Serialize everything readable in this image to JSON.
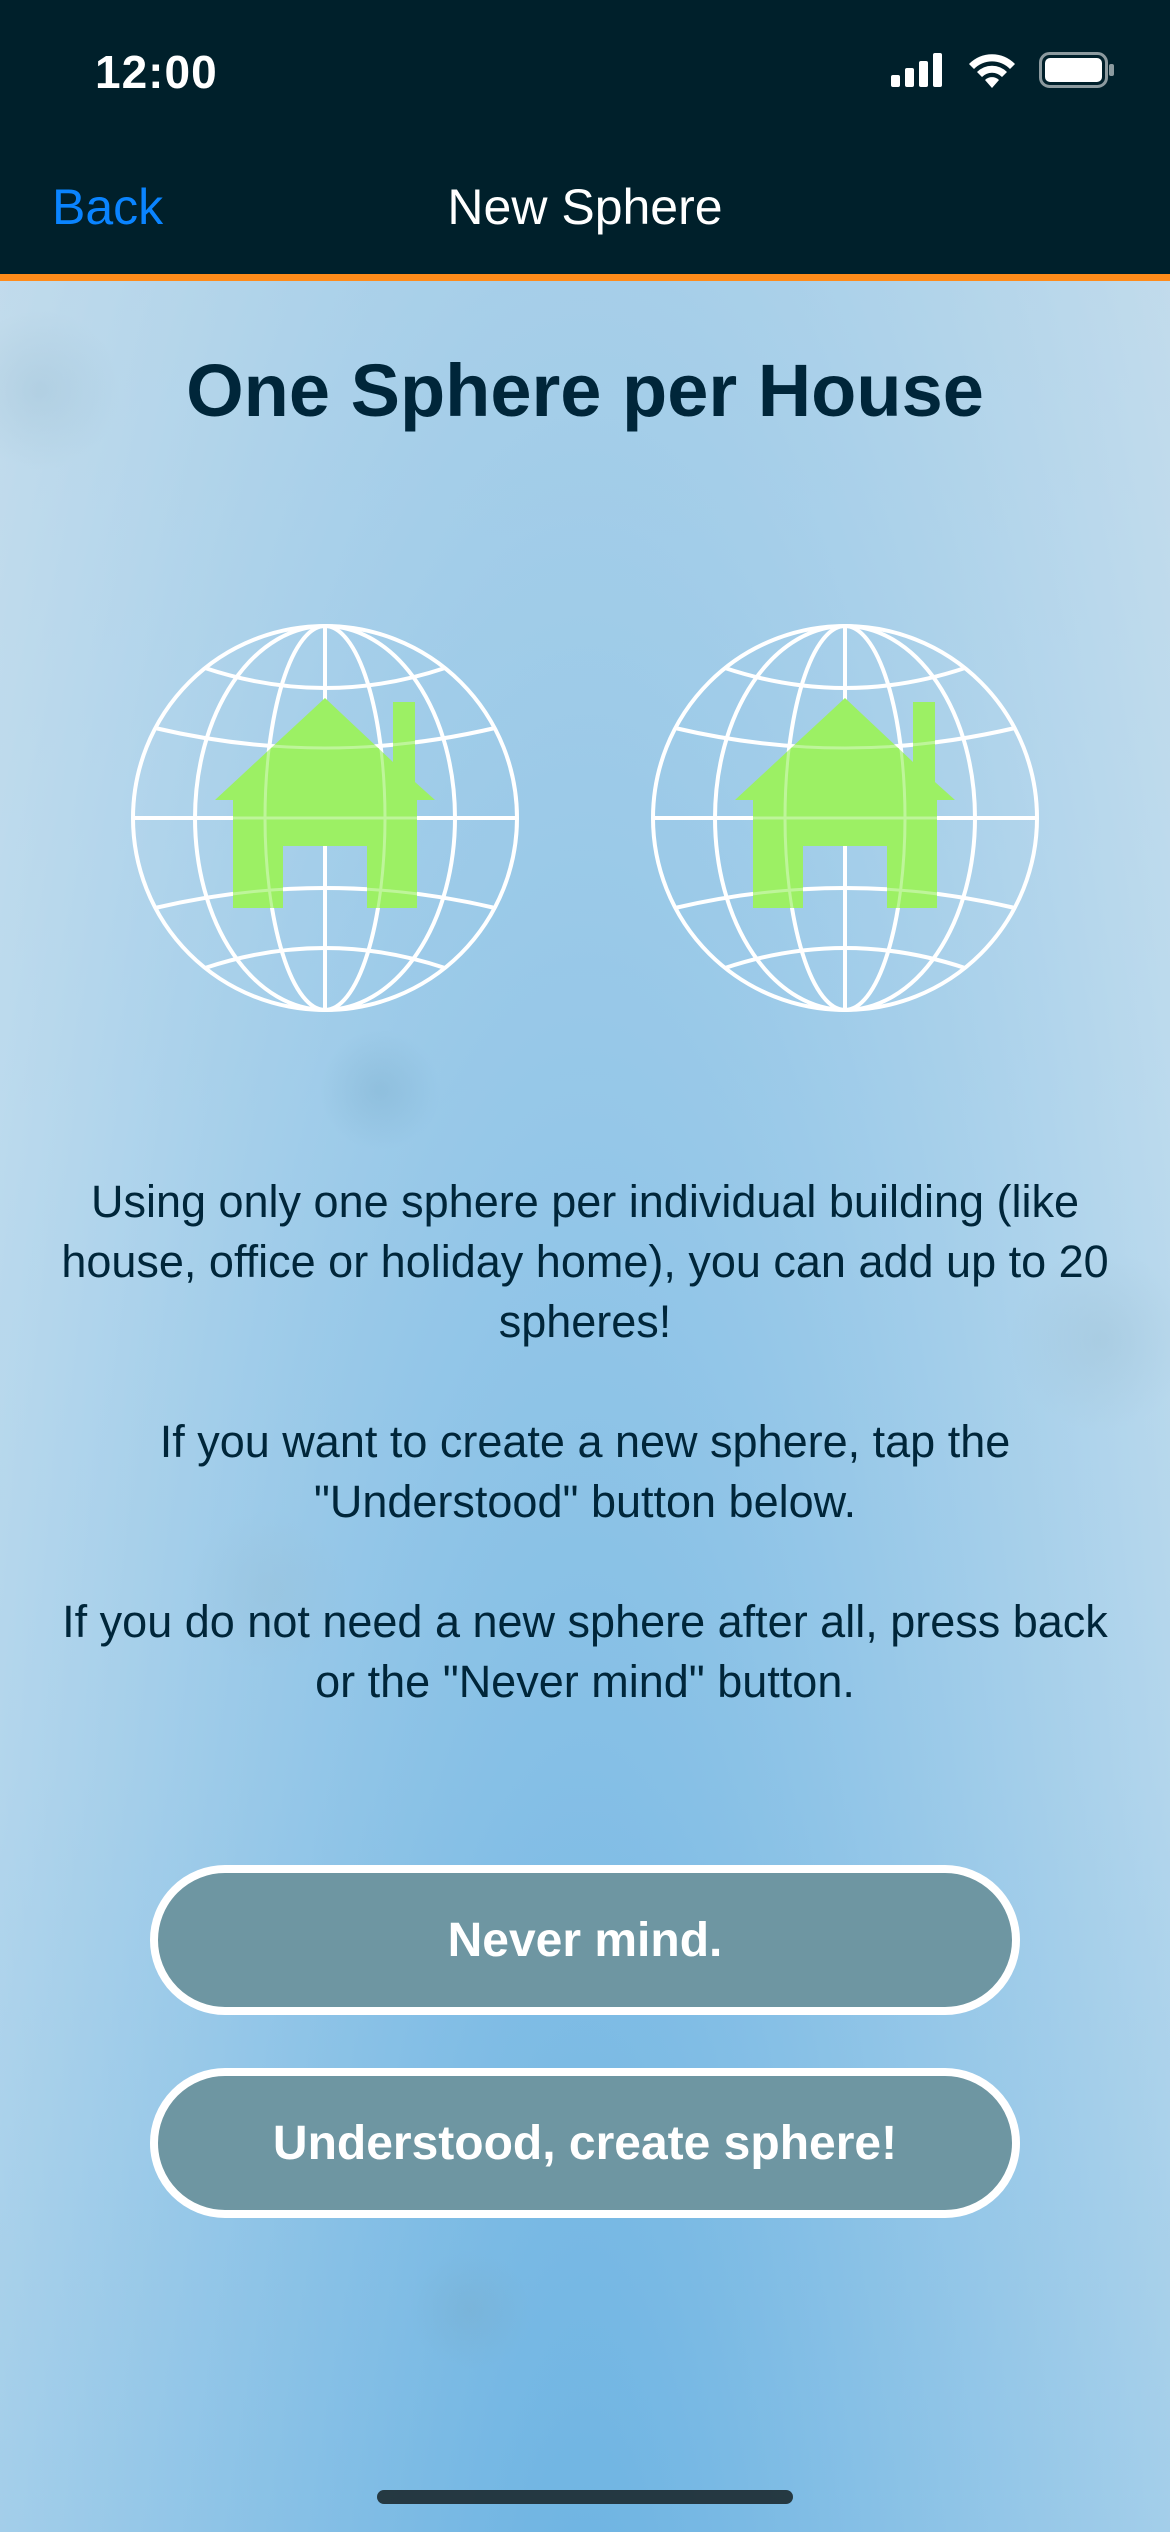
{
  "status_bar": {
    "time": "12:00",
    "icons": [
      "cellular-signal-icon",
      "wifi-icon",
      "battery-icon"
    ]
  },
  "nav": {
    "back_label": "Back",
    "title": "New Sphere"
  },
  "page": {
    "title": "One Sphere per House",
    "illustrations": [
      "globe-house-icon",
      "globe-house-icon"
    ],
    "paragraphs": [
      "Using only one sphere per individual building (like house, office or holiday home), you can add up to 20 spheres!",
      "If you want to create a new sphere, tap the \"Understood\" button below.",
      "If you do not need a new sphere after all, press back or the \"Never mind\" button."
    ]
  },
  "buttons": {
    "never_mind": "Never mind.",
    "create": "Understood, create sphere!"
  },
  "colors": {
    "nav_background": "#00202b",
    "nav_accent": "#ff8b1a",
    "back_link": "#0a84ff",
    "house": "#9cf064",
    "button_fill": "#6e96a2",
    "title_text": "#00263a"
  }
}
